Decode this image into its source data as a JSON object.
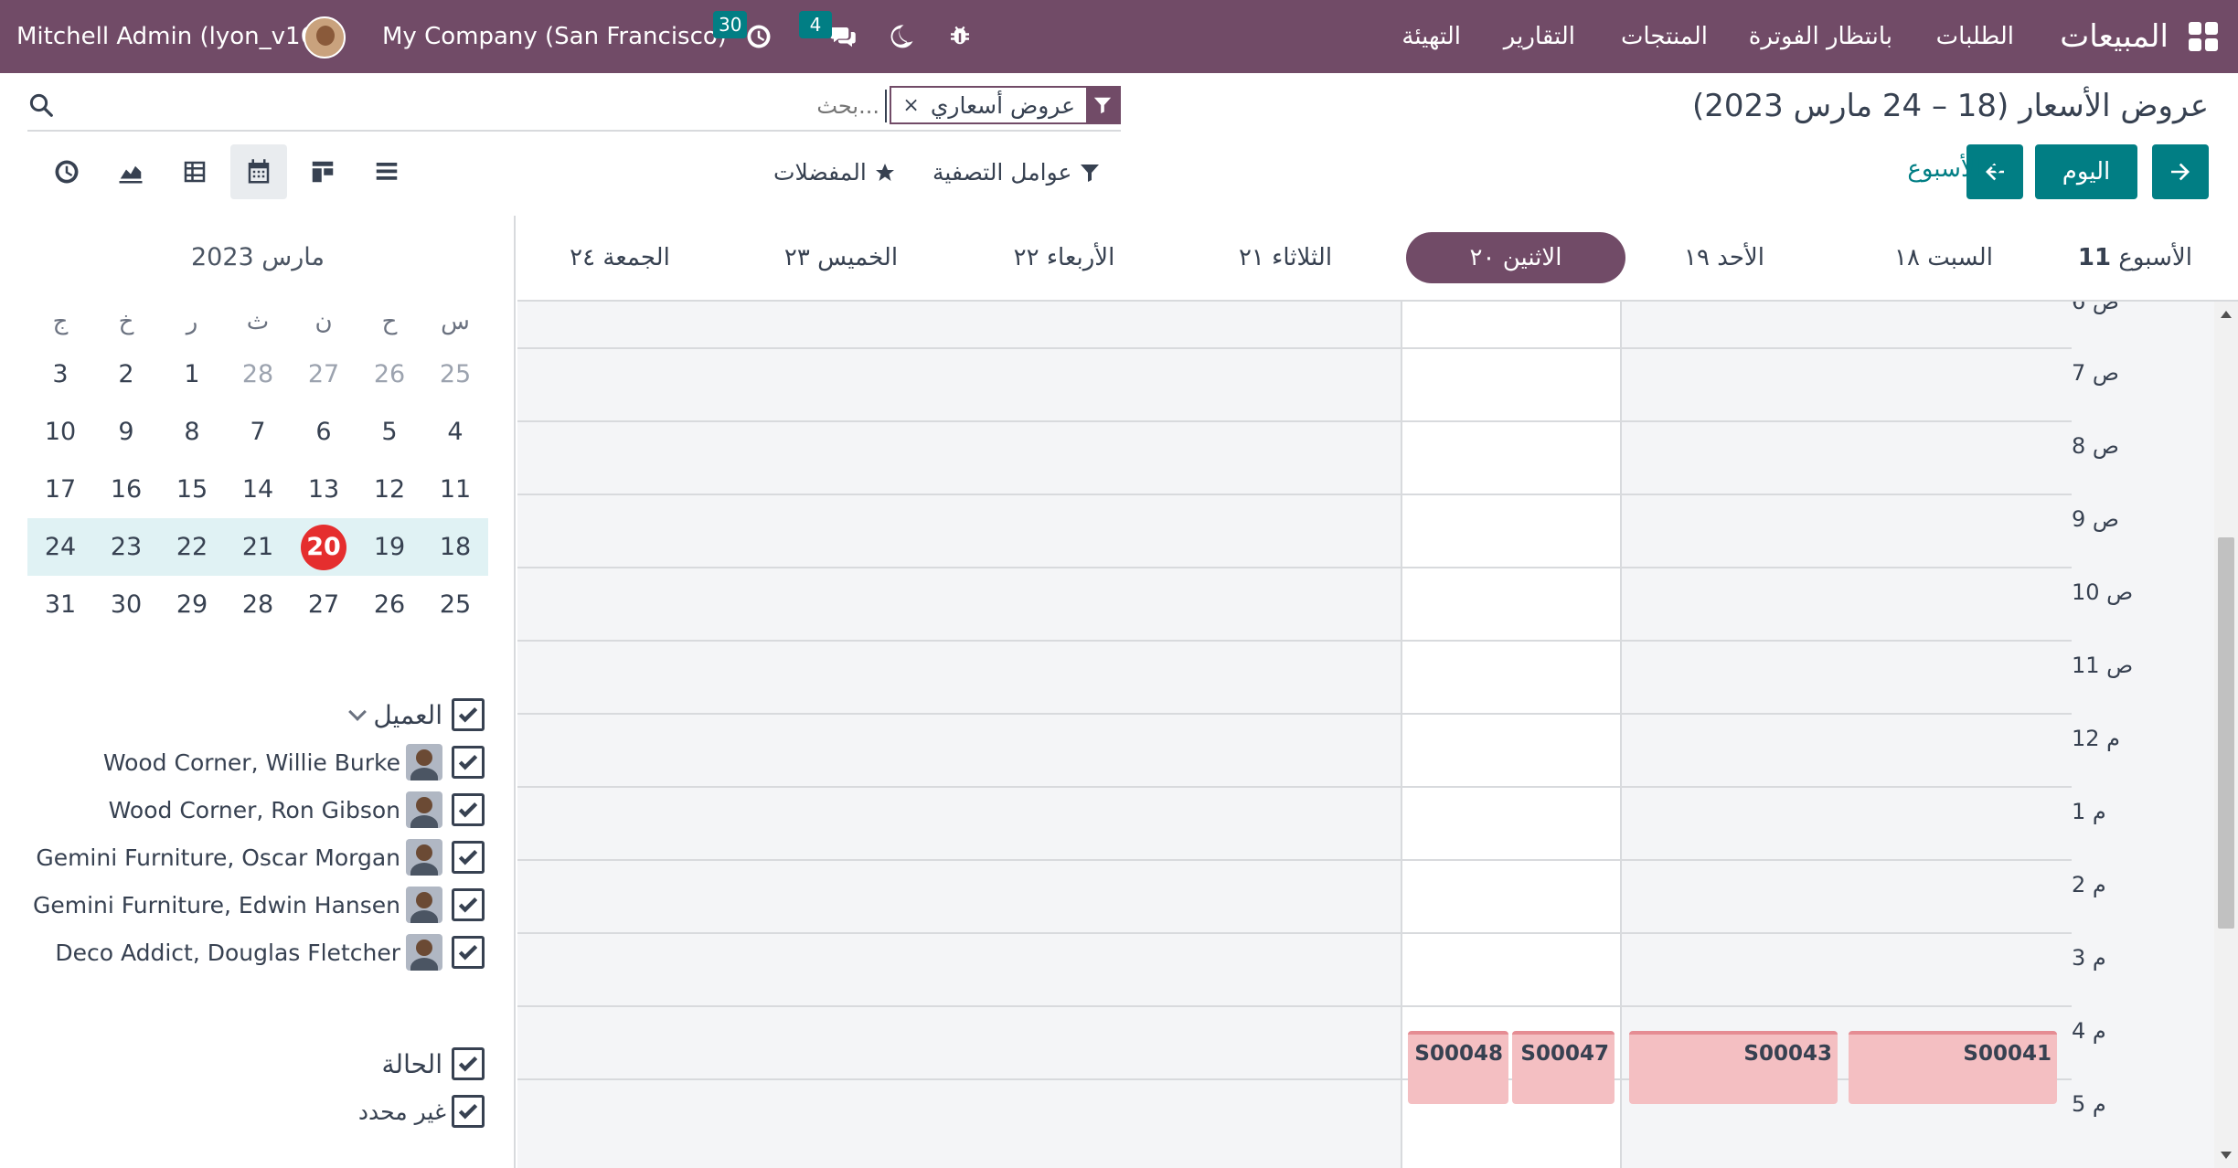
{
  "navbar": {
    "brand": "المبيعات",
    "menus": [
      "الطلبات",
      "بانتظار الفوترة",
      "المنتجات",
      "التقارير",
      "التهيئة"
    ],
    "user": "Mitchell Admin (lyon_v16)",
    "company": "My Company (San Francisco)",
    "activity_count": "30",
    "message_count": "4"
  },
  "title": "عروض الأسعار (18 – 24 مارس 2023)",
  "search": {
    "facet": "عروض أسعاري",
    "placeholder": "بحث..."
  },
  "controls": {
    "today": "اليوم",
    "scale": "الأسبوع",
    "filters": "عوامل التصفية",
    "favorites": "المفضلات"
  },
  "mini_calendar": {
    "month": "مارس 2023",
    "weekdays": [
      "س",
      "ح",
      "ن",
      "ث",
      "ر",
      "خ",
      "ج"
    ],
    "weeks": [
      [
        "25",
        "26",
        "27",
        "28",
        "1",
        "2",
        "3"
      ],
      [
        "4",
        "5",
        "6",
        "7",
        "8",
        "9",
        "10"
      ],
      [
        "11",
        "12",
        "13",
        "14",
        "15",
        "16",
        "17"
      ],
      [
        "18",
        "19",
        "20",
        "21",
        "22",
        "23",
        "24"
      ],
      [
        "25",
        "26",
        "27",
        "28",
        "29",
        "30",
        "31"
      ]
    ],
    "active_week": 3,
    "today": "20"
  },
  "filters": {
    "customer": {
      "label": "العميل",
      "items": [
        "Wood Corner, Willie Burke",
        "Wood Corner, Ron Gibson",
        "Gemini Furniture, Oscar Morgan",
        "Gemini Furniture, Edwin Hansen",
        "Deco Addict, Douglas Fletcher"
      ]
    },
    "state": {
      "label": "الحالة",
      "items": [
        "غير محدد"
      ]
    }
  },
  "calendar": {
    "week_label": "الأسبوع",
    "week_number": "11",
    "days": [
      "السبت ١٨",
      "الأحد ١٩",
      "الاثنين ٢٠",
      "الثلاثاء ٢١",
      "الأربعاء ٢٢",
      "الخميس ٢٣",
      "الجمعة ٢٤"
    ],
    "today_index": 2,
    "hours": [
      "ص 6",
      "ص 7",
      "ص 8",
      "ص 9",
      "ص 10",
      "ص 11",
      "م 12",
      "م 1",
      "م 2",
      "م 3",
      "م 4",
      "م 5"
    ],
    "events": [
      {
        "name": "S00041",
        "day": "السبت ١٨"
      },
      {
        "name": "S00043",
        "day": "الأحد ١٩"
      },
      {
        "name": "S00047",
        "day": "الاثنين ٢٠"
      },
      {
        "name": "S00048",
        "day": "الاثنين ٢٠"
      }
    ],
    "event_color": "#f4bfc2"
  },
  "colors": {
    "brand": "#714b67",
    "primary": "#017e84",
    "today_badge": "#e52e2e"
  }
}
